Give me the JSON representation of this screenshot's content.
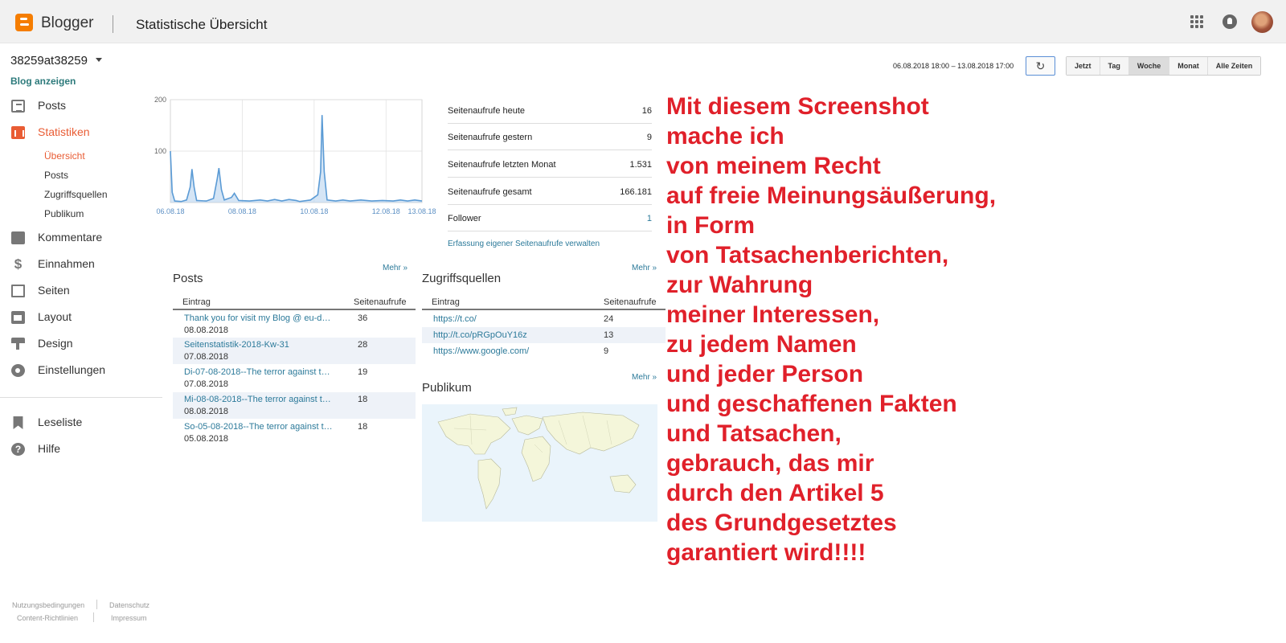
{
  "header": {
    "brand": "Blogger",
    "title": "Statistische Übersicht"
  },
  "sidebar": {
    "blog_name": "38259at38259",
    "view_blog": "Blog anzeigen",
    "items": [
      {
        "label": "Posts",
        "icon": "posts-icon"
      },
      {
        "label": "Statistiken",
        "icon": "stats-icon"
      },
      {
        "label": "Kommentare",
        "icon": "comment-icon"
      },
      {
        "label": "Einnahmen",
        "icon": "dollar-icon"
      },
      {
        "label": "Seiten",
        "icon": "pages-icon"
      },
      {
        "label": "Layout",
        "icon": "layout-icon"
      },
      {
        "label": "Design",
        "icon": "design-icon"
      },
      {
        "label": "Einstellungen",
        "icon": "gear-icon"
      }
    ],
    "stats_subitems": [
      "Übersicht",
      "Posts",
      "Zugriffsquellen",
      "Publikum"
    ],
    "bottom_items": [
      {
        "label": "Leseliste",
        "icon": "bookmark-icon"
      },
      {
        "label": "Hilfe",
        "icon": "help-icon"
      }
    ],
    "footer": {
      "terms": "Nutzungsbedingungen",
      "privacy": "Datenschutz",
      "content_policy": "Content-Richtlinien",
      "imprint": "Impressum"
    }
  },
  "toolbar": {
    "date_range": "06.08.2018 18:00 – 13.08.2018 17:00",
    "ranges": [
      "Jetzt",
      "Tag",
      "Woche",
      "Monat",
      "Alle Zeiten"
    ],
    "active_range": "Woche"
  },
  "stats": [
    {
      "label": "Seitenaufrufe heute",
      "value": "16"
    },
    {
      "label": "Seitenaufrufe gestern",
      "value": "9"
    },
    {
      "label": "Seitenaufrufe letzten Monat",
      "value": "1.531"
    },
    {
      "label": "Seitenaufrufe gesamt",
      "value": "166.181"
    },
    {
      "label": "Follower",
      "value": "1"
    }
  ],
  "stats_link": "Erfassung eigener Seitenaufrufe verwalten",
  "posts_section": {
    "title": "Posts",
    "more": "Mehr »",
    "col_entry": "Eintrag",
    "col_views": "Seitenaufrufe",
    "rows": [
      {
        "title": "Thank you for visit my Blog @ eu-d…",
        "date": "08.08.2018",
        "views": "36"
      },
      {
        "title": "Seitenstatistik-2018-Kw-31",
        "date": "07.08.2018",
        "views": "28"
      },
      {
        "title": "Di-07-08-2018--The terror against th…",
        "date": "07.08.2018",
        "views": "19"
      },
      {
        "title": "Mi-08-08-2018--The terror against th…",
        "date": "08.08.2018",
        "views": "18"
      },
      {
        "title": "So-05-08-2018--The terror against t…",
        "date": "05.08.2018",
        "views": "18"
      }
    ]
  },
  "sources_section": {
    "title": "Zugriffsquellen",
    "more": "Mehr »",
    "col_entry": "Eintrag",
    "col_views": "Seitenaufrufe",
    "rows": [
      {
        "source": "https://t.co/",
        "views": "24"
      },
      {
        "source": "http://t.co/pRGpOuY16z",
        "views": "13"
      },
      {
        "source": "https://www.google.com/",
        "views": "9"
      }
    ]
  },
  "audience_section": {
    "title": "Publikum",
    "more": "Mehr »"
  },
  "overlay_text": [
    "Mit diesem Screenshot",
    "mache ich",
    "von meinem Recht",
    "auf freie Meinungsäußerung,",
    "in Form",
    "von Tatsachenberichten,",
    "zur Wahrung",
    "meiner Interessen,",
    "zu jedem Namen",
    "und jeder Person",
    "und geschaffenen Fakten",
    "und Tatsachen,",
    "gebrauch, das mir",
    "durch den Artikel 5",
    "des Grundgesetztes",
    "garantiert wird!!!!"
  ],
  "colors": {
    "accent": "#e95c34",
    "link": "#2c7a9a",
    "overlay": "#e0202a",
    "chart_line": "#5b9bd5"
  },
  "chart_data": {
    "type": "area",
    "x_ticks": [
      "06.08.18",
      "08.08.18",
      "10.08.18",
      "12.08.18",
      "13.08.18"
    ],
    "y_ticks": [
      "100",
      "200"
    ],
    "ylim": [
      0,
      200
    ],
    "xlim": [
      0,
      7
    ],
    "values": [
      [
        0.0,
        100
      ],
      [
        0.05,
        20
      ],
      [
        0.12,
        3
      ],
      [
        0.3,
        2
      ],
      [
        0.45,
        5
      ],
      [
        0.55,
        30
      ],
      [
        0.6,
        65
      ],
      [
        0.66,
        30
      ],
      [
        0.73,
        4
      ],
      [
        1.0,
        3
      ],
      [
        1.2,
        8
      ],
      [
        1.3,
        45
      ],
      [
        1.35,
        67
      ],
      [
        1.42,
        25
      ],
      [
        1.5,
        5
      ],
      [
        1.7,
        10
      ],
      [
        1.78,
        18
      ],
      [
        1.9,
        4
      ],
      [
        2.2,
        3
      ],
      [
        2.5,
        5
      ],
      [
        2.7,
        3
      ],
      [
        2.9,
        6
      ],
      [
        3.1,
        3
      ],
      [
        3.3,
        6
      ],
      [
        3.5,
        4
      ],
      [
        3.6,
        2
      ],
      [
        3.9,
        5
      ],
      [
        4.1,
        15
      ],
      [
        4.18,
        60
      ],
      [
        4.22,
        170
      ],
      [
        4.28,
        60
      ],
      [
        4.36,
        5
      ],
      [
        4.6,
        3
      ],
      [
        4.8,
        5
      ],
      [
        5.0,
        3
      ],
      [
        5.3,
        5
      ],
      [
        5.6,
        3
      ],
      [
        5.9,
        4
      ],
      [
        6.2,
        3
      ],
      [
        6.4,
        5
      ],
      [
        6.6,
        3
      ],
      [
        6.8,
        5
      ],
      [
        7.0,
        3
      ]
    ]
  }
}
